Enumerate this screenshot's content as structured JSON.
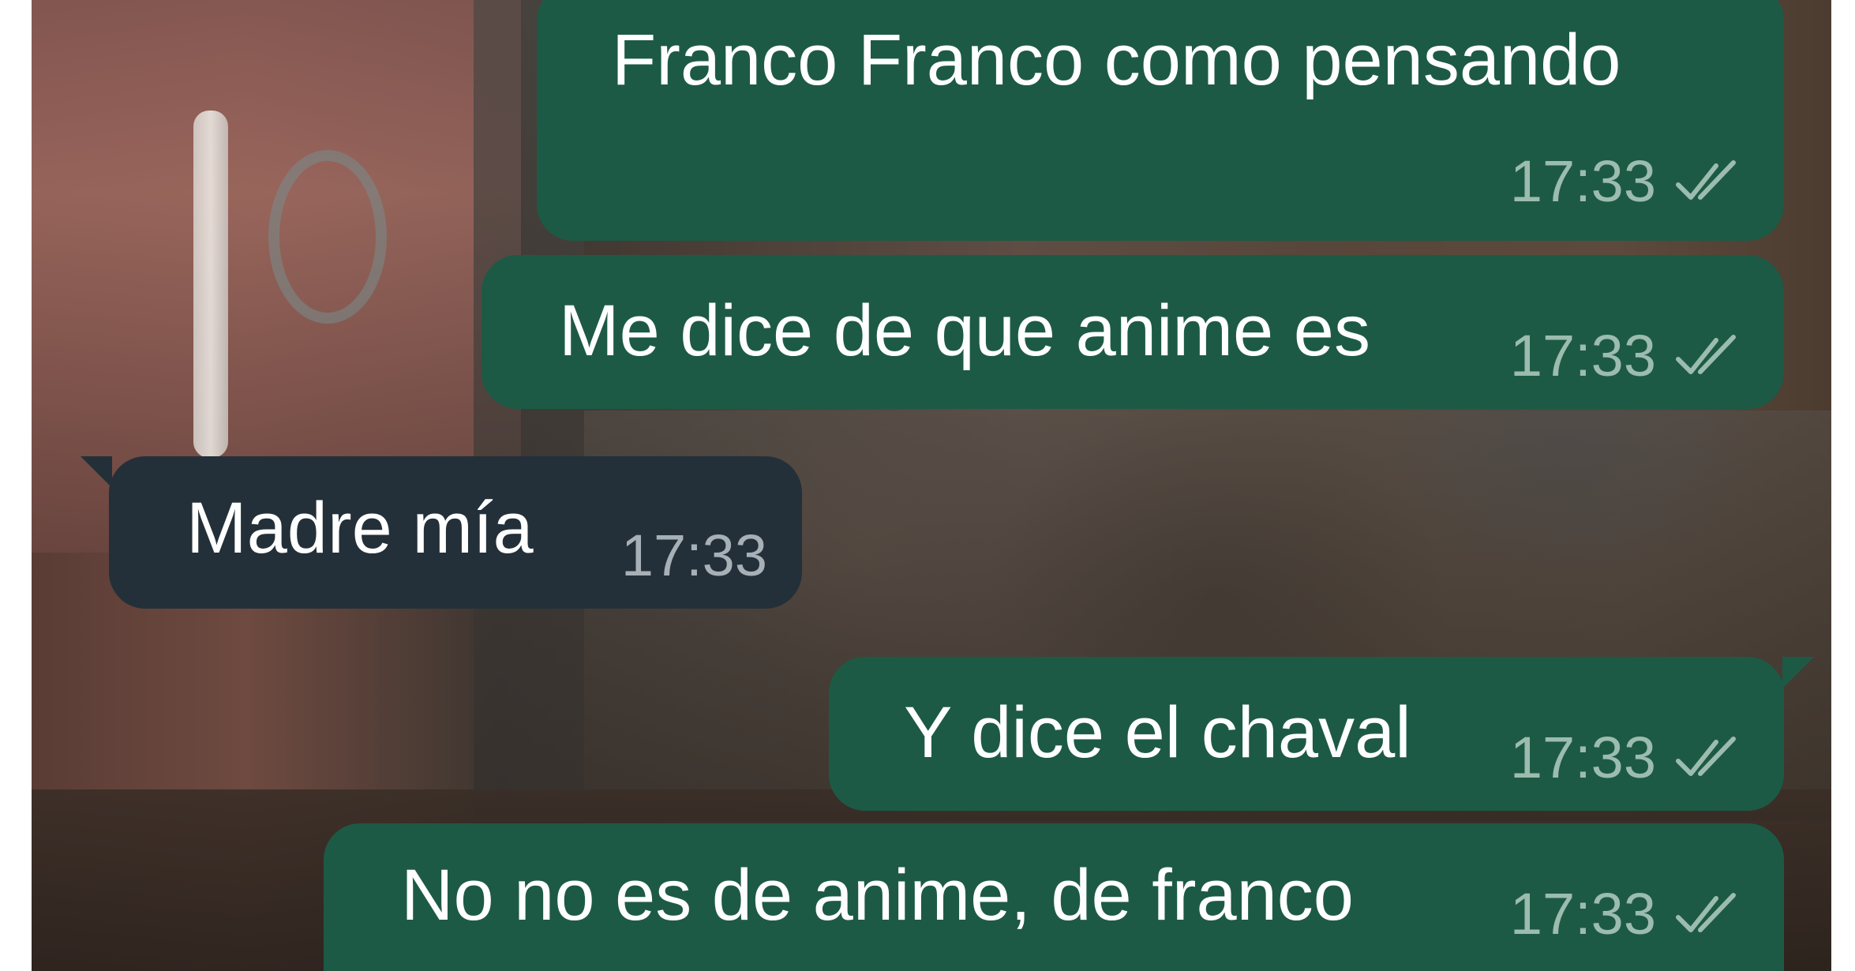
{
  "chat": {
    "messages": [
      {
        "direction": "outgoing",
        "text": "Franco Franco como pensando",
        "time": "17:33",
        "status_icon": "double-check-icon"
      },
      {
        "direction": "outgoing",
        "text": "Me dice de que anime es",
        "time": "17:33",
        "status_icon": "double-check-icon"
      },
      {
        "direction": "incoming",
        "text": "Madre mía",
        "time": "17:33"
      },
      {
        "direction": "outgoing",
        "text": "Y dice el chaval",
        "time": "17:33",
        "status_icon": "double-check-icon"
      },
      {
        "direction": "outgoing",
        "text": "No no es de anime, de franco",
        "time": "17:33",
        "status_icon": "double-check-icon"
      }
    ]
  },
  "colors": {
    "outgoing_bubble": "#1d5a45",
    "incoming_bubble": "#233039",
    "message_text": "#ffffff",
    "timestamp_outgoing": "#9cbcb0",
    "timestamp_incoming": "#a7b0b6"
  }
}
